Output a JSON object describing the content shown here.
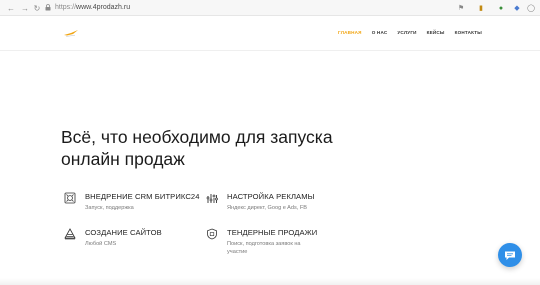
{
  "browser": {
    "url_protocol": "https://",
    "url_host": "www.4prodazh.ru"
  },
  "header": {
    "logo_icon": "logo-bird-icon",
    "menu": [
      {
        "label": "ГЛАВНАЯ",
        "active": true
      },
      {
        "label": "О НАС",
        "active": false
      },
      {
        "label": "УСЛУГИ",
        "active": false
      },
      {
        "label": "КЕЙСЫ",
        "active": false
      },
      {
        "label": "КОНТАКТЫ",
        "active": false
      }
    ]
  },
  "hero": {
    "title_line1": "Всё, что необходимо для запуска",
    "title_line2": "онлайн продаж"
  },
  "services": [
    {
      "icon": "crm-icon",
      "title": "ВНЕДРЕНИЕ CRM БИТРИКС24",
      "desc": "Запуск, поддержка"
    },
    {
      "icon": "ads-settings-icon",
      "title": "НАСТРОЙКА РЕКЛАМЫ",
      "desc": "Яндекс директ, Goog e Ads, FB"
    },
    {
      "icon": "website-icon",
      "title": "СОЗДАНИЕ САЙТОВ",
      "desc": "Любой CMS"
    },
    {
      "icon": "shield-icon",
      "title": "ТЕНДЕРНЫЕ ПРОДАЖИ",
      "desc": "Поиск, подготовка заявок на участие"
    }
  ],
  "colors": {
    "accent": "#f1a512",
    "chat_button": "#2f8fe8"
  },
  "chat": {
    "icon": "chat-bubble-icon"
  }
}
